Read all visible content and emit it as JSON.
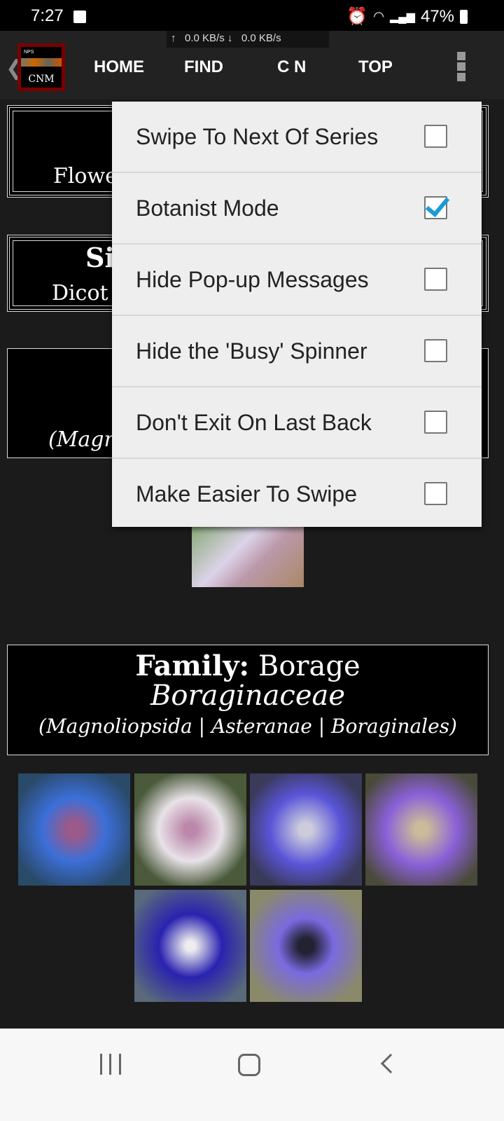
{
  "status_bar": {
    "time": "7:27",
    "battery": "47%"
  },
  "app_bar": {
    "net_speed": "↑   0.0 KB/s ↓   0.0 KB/s",
    "logo_top": "NPS",
    "logo_text": "CNM",
    "nav": [
      "HOME",
      "FIND",
      "C N",
      "TOP"
    ]
  },
  "content": {
    "box1_text": "Flowe",
    "box2_title": "Si",
    "box2_sub": "Dicot f",
    "box3_sub": "(Magn",
    "family": {
      "label": "Family:",
      "common": "Borage",
      "latin": "Boraginaceae",
      "class": "(Magnoliopsida | Asteranae | Boraginales)"
    }
  },
  "menu": {
    "items": [
      {
        "label": "Swipe To Next Of Series",
        "checked": false
      },
      {
        "label": "Botanist Mode",
        "checked": true
      },
      {
        "label": "Hide Pop-up Messages",
        "checked": false
      },
      {
        "label": "Hide the 'Busy' Spinner",
        "checked": false
      },
      {
        "label": "Don't Exit On Last Back",
        "checked": false
      },
      {
        "label": "Make Easier To Swipe",
        "checked": false
      }
    ]
  },
  "colors": {
    "accent": "#1a9bd7",
    "logo_border": "#7a0000"
  }
}
